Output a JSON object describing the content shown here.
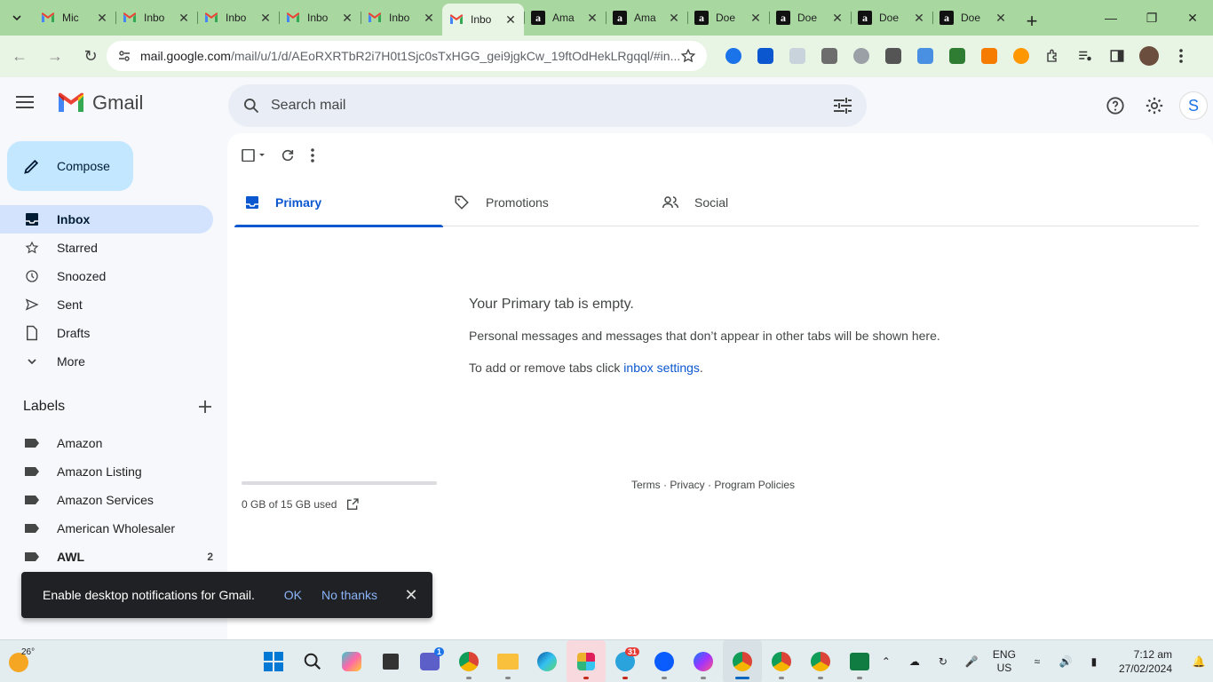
{
  "browser": {
    "tabs": [
      {
        "title": "Mic",
        "icon": "gmail"
      },
      {
        "title": "Inbo",
        "icon": "gmail"
      },
      {
        "title": "Inbo",
        "icon": "gmail"
      },
      {
        "title": "Inbo",
        "icon": "gmail"
      },
      {
        "title": "Inbo",
        "icon": "gmail"
      },
      {
        "title": "Inbo",
        "icon": "gmail",
        "active": true
      },
      {
        "title": "Ama",
        "icon": "amazon"
      },
      {
        "title": "Ama",
        "icon": "amazon"
      },
      {
        "title": "Doe",
        "icon": "amazon"
      },
      {
        "title": "Doe",
        "icon": "amazon"
      },
      {
        "title": "Doe",
        "icon": "amazon"
      },
      {
        "title": "Doe",
        "icon": "amazon"
      }
    ],
    "url_host": "mail.google.com",
    "url_path": "/mail/u/1/d/AEoRXRTbR2i7H0t1Sjc0sTxHGG_gei9jgkCw_19ftOdHekLRgqql/#in..."
  },
  "gmail": {
    "brand": "Gmail",
    "search_placeholder": "Search mail",
    "avatar_letter": "S",
    "compose_label": "Compose",
    "nav": [
      {
        "label": "Inbox",
        "icon": "inbox-icon",
        "active": true
      },
      {
        "label": "Starred",
        "icon": "star-icon"
      },
      {
        "label": "Snoozed",
        "icon": "clock-icon"
      },
      {
        "label": "Sent",
        "icon": "send-icon"
      },
      {
        "label": "Drafts",
        "icon": "draft-icon"
      },
      {
        "label": "More",
        "icon": "chevron-down-icon"
      }
    ],
    "labels_heading": "Labels",
    "labels": [
      {
        "label": "Amazon",
        "count": ""
      },
      {
        "label": "Amazon Listing",
        "count": ""
      },
      {
        "label": "Amazon Services",
        "count": ""
      },
      {
        "label": "American Wholesaler",
        "count": ""
      },
      {
        "label": "AWL",
        "count": "2",
        "bold": true
      }
    ],
    "category_tabs": [
      {
        "label": "Primary",
        "icon": "inbox-icon",
        "active": true
      },
      {
        "label": "Promotions",
        "icon": "tag-icon"
      },
      {
        "label": "Social",
        "icon": "people-icon"
      }
    ],
    "empty_title": "Your Primary tab is empty.",
    "empty_desc": "Personal messages and messages that don’t appear in other tabs will be shown here.",
    "empty_settings_prefix": "To add or remove tabs click ",
    "empty_settings_link": "inbox settings",
    "empty_settings_suffix": ".",
    "storage_text": "0 GB of 15 GB used",
    "storage_fraction": 0.0,
    "footer": {
      "terms": "Terms",
      "sep1": " · ",
      "privacy": "Privacy",
      "sep2": " · ",
      "policies": "Program Policies"
    },
    "snackbar": {
      "message": "Enable desktop notifications for Gmail.",
      "ok": "OK",
      "no_thanks": "No thanks"
    }
  },
  "taskbar": {
    "temperature": "26°",
    "lang_line1": "ENG",
    "lang_line2": "US",
    "time": "7:12 am",
    "date": "27/02/2024",
    "badges": {
      "teams": "1",
      "telegram": "31"
    }
  },
  "colors": {
    "accent": "#0b57d0",
    "compose_bg": "#c2e7ff",
    "active_nav": "#d3e3fd",
    "tabstrip": "#a8d8a0"
  }
}
